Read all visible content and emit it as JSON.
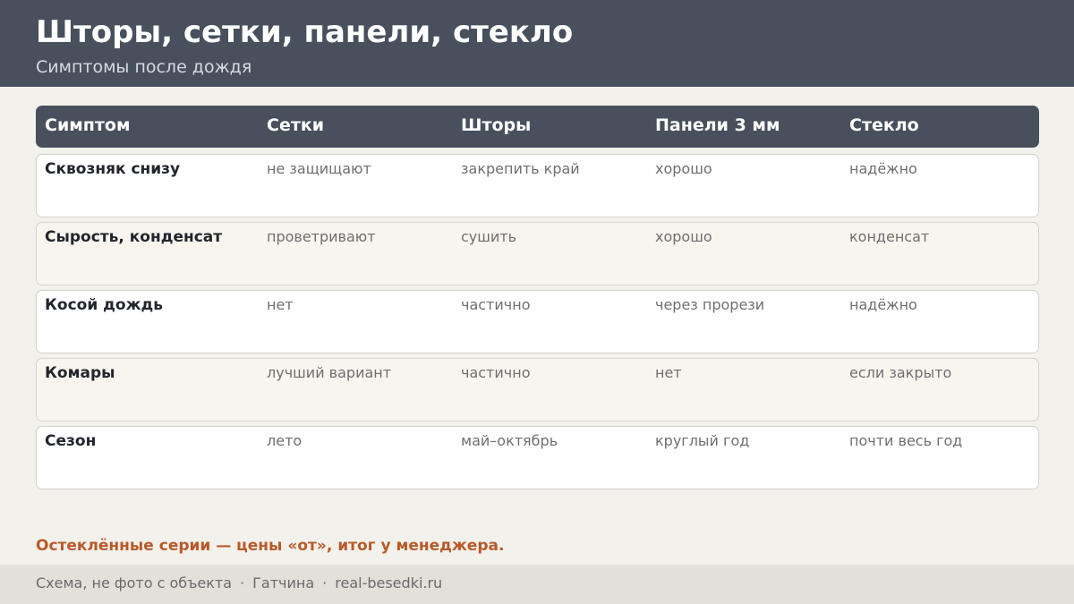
{
  "header": {
    "title": "Шторы, сетки, панели, стекло",
    "subtitle": "Симптомы после дождя"
  },
  "table": {
    "columns": [
      "Симптом",
      "Сетки",
      "Шторы",
      "Панели 3 мм",
      "Стекло"
    ],
    "rows": [
      [
        "Сквозняк снизу",
        "не защищают",
        "закрепить край",
        "хорошо",
        "надёжно"
      ],
      [
        "Сырость, конденсат",
        "проветривают",
        "сушить",
        "хорошо",
        "конденсат"
      ],
      [
        "Косой дождь",
        "нет",
        "частично",
        "через прорези",
        "надёжно"
      ],
      [
        "Комары",
        "лучший вариант",
        "частично",
        "нет",
        "если закрыто"
      ],
      [
        "Сезон",
        "лето",
        "май–октябрь",
        "круглый год",
        "почти весь год"
      ]
    ]
  },
  "note": "Остеклённые серии — цены «от», итог у менеджера.",
  "footer": {
    "parts": [
      "Схема, не фото с объекта",
      "Гатчина",
      "real-besedki.ru"
    ],
    "separator": "·"
  },
  "colors": {
    "header_bg": "#47505c",
    "page_bg": "#f3f1ec",
    "accent": "#b85a2a",
    "footer_bg": "#e3e0da"
  }
}
